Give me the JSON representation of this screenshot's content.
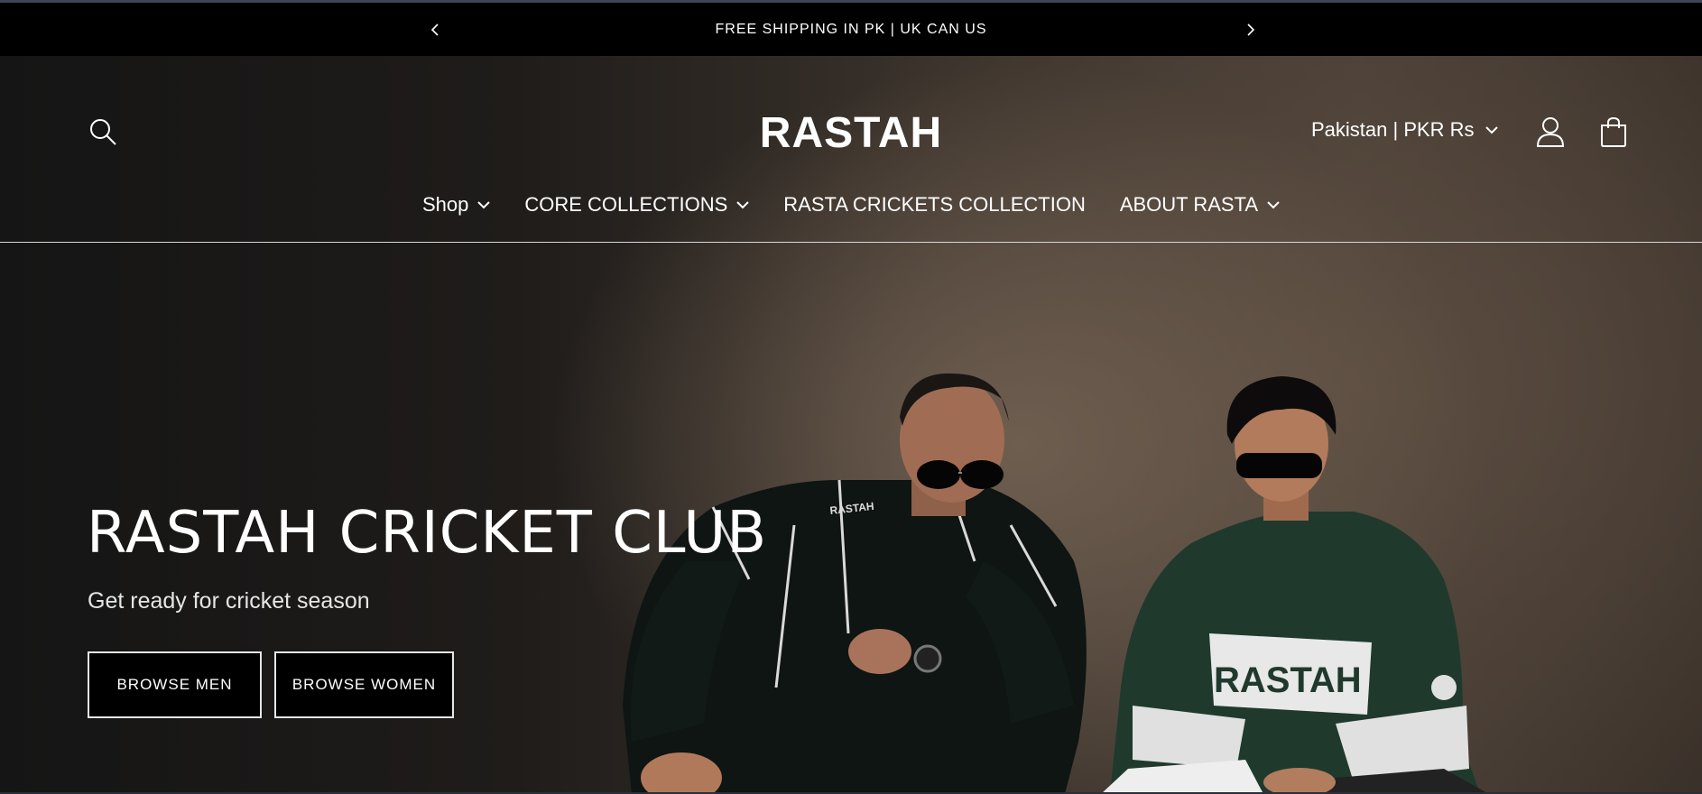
{
  "announcement": {
    "message": "FREE SHIPPING IN PK | UK CAN US",
    "prev_icon": "chevron-left-icon",
    "next_icon": "chevron-right-icon"
  },
  "header": {
    "logo": "RASTAH",
    "search_icon": "search-icon",
    "locale_label": "Pakistan | PKR Rs",
    "account_icon": "account-icon",
    "cart_icon": "cart-icon"
  },
  "nav": {
    "items": [
      {
        "label": "Shop",
        "has_dropdown": true
      },
      {
        "label": "CORE COLLECTIONS",
        "has_dropdown": true
      },
      {
        "label": "RASTA CRICKETS COLLECTION",
        "has_dropdown": false
      },
      {
        "label": "ABOUT RASTA",
        "has_dropdown": true
      }
    ]
  },
  "hero": {
    "title": "RASTAH CRICKET CLUB",
    "subtitle": "Get ready for cricket season",
    "buttons": {
      "men": "BROWSE MEN",
      "women": "BROWSE WOMEN"
    },
    "jacket_text_left": "RASTAH",
    "jacket_text_right": "RASTAH"
  },
  "colors": {
    "background": "#000000",
    "text": "#ffffff",
    "jacket_green": "#1f3a2c"
  }
}
